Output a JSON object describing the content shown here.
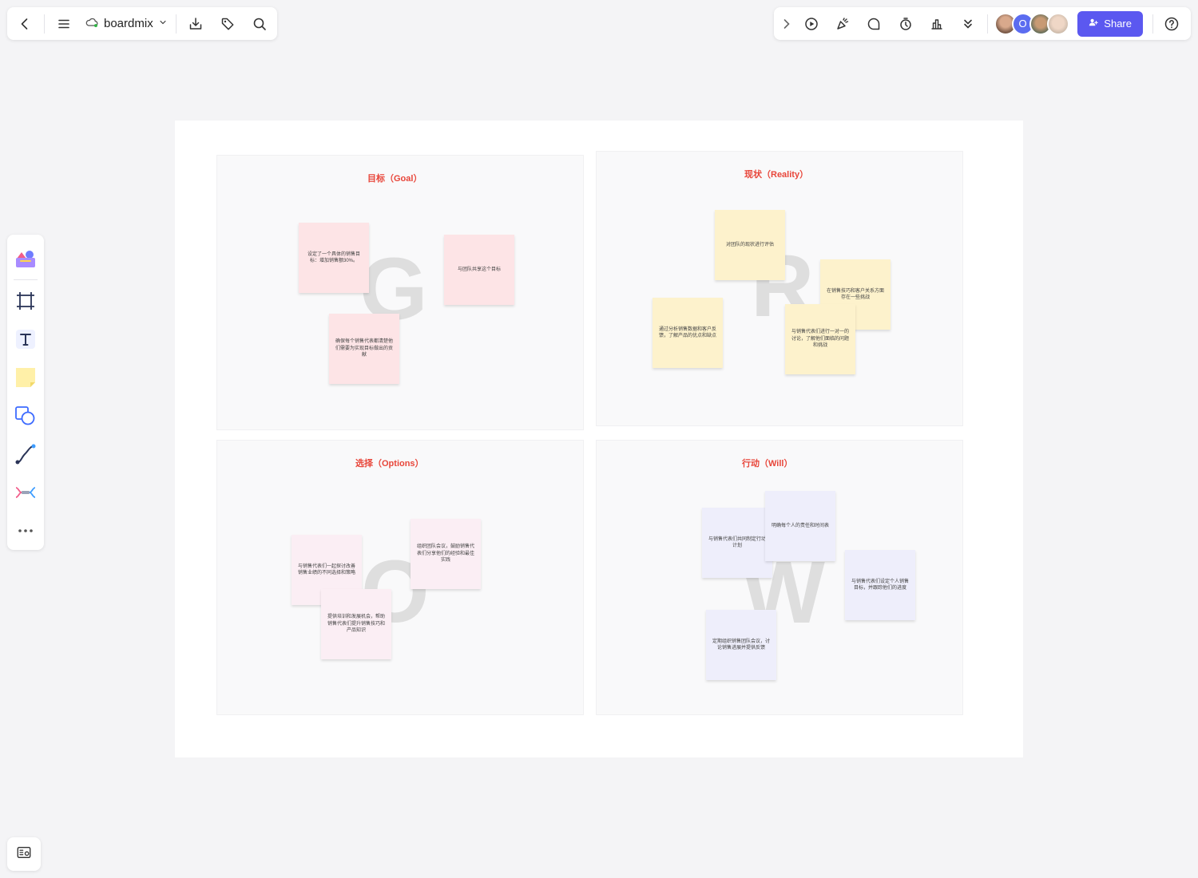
{
  "toolbar": {
    "app_name": "boardmix",
    "share_label": "Share",
    "avatar_o_initial": "O"
  },
  "board": {
    "goal": {
      "title": "目标（Goal）",
      "letter": "G",
      "notes": [
        "设定了一个具体的销售目标：增加销售额30%。",
        "与团队共享这个目标",
        "确保每个销售代表都清楚他们需要为实现目标做出的贡献"
      ]
    },
    "reality": {
      "title": "现状（Reality）",
      "letter": "R",
      "notes": [
        "对团队的现状进行评估",
        "在销售技巧和客户关系方面存在一些挑战",
        "通过分析销售数据和客户反馈，了解产品的优点和缺点",
        "与销售代表们进行一对一的讨论，了解他们面临的问题和挑战"
      ]
    },
    "options": {
      "title": "选择（Options）",
      "letter": "O",
      "notes": [
        "与销售代表们一起探讨改善销售业绩的不同选择和策略",
        "组织团队会议，鼓励销售代表们分享他们的经验和最佳实践",
        "提供培训和发展机会，帮助销售代表们提升销售技巧和产品知识"
      ]
    },
    "will": {
      "title": "行动（Will）",
      "letter": "W",
      "notes": [
        "与销售代表们共同制定行动计划",
        "明确每个人的责任和时间表",
        "与销售代表们设定个人销售目标，并跟踪他们的进度",
        "定期组织销售团队会议，讨论销售进展并提供反馈"
      ]
    }
  }
}
